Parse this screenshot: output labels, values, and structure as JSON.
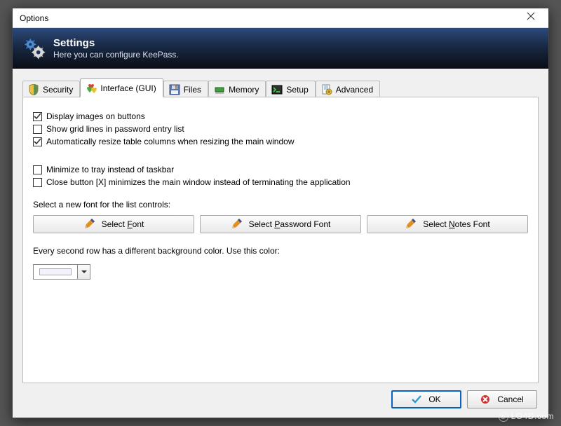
{
  "window": {
    "title": "Options"
  },
  "header": {
    "title": "Settings",
    "subtitle": "Here you can configure KeePass."
  },
  "tabs": [
    {
      "label": "Security",
      "icon": "shield-yellow"
    },
    {
      "label": "Interface (GUI)",
      "icon": "hearts"
    },
    {
      "label": "Files",
      "icon": "floppy"
    },
    {
      "label": "Memory",
      "icon": "chip-green"
    },
    {
      "label": "Setup",
      "icon": "terminal"
    },
    {
      "label": "Advanced",
      "icon": "page-blue"
    }
  ],
  "active_tab": 1,
  "checkboxes": [
    {
      "label": "Display images on buttons",
      "checked": true
    },
    {
      "label": "Show grid lines in password entry list",
      "checked": false
    },
    {
      "label": "Automatically resize table columns when resizing the main window",
      "checked": true
    }
  ],
  "checkboxes2": [
    {
      "label": "Minimize to tray instead of taskbar",
      "checked": false
    },
    {
      "label": "Close button [X] minimizes the main window instead of terminating the application",
      "checked": false
    }
  ],
  "font_section": {
    "label": "Select a new font for the list controls:",
    "buttons": [
      {
        "pre": "Select ",
        "u": "F",
        "post": "ont"
      },
      {
        "pre": "Select ",
        "u": "P",
        "post": "assword Font"
      },
      {
        "pre": "Select ",
        "u": "N",
        "post": "otes Font"
      }
    ]
  },
  "color_section": {
    "label": "Every second row has a different background color. Use this color:",
    "value": "#f2f2fb"
  },
  "dialog_buttons": {
    "ok": "OK",
    "cancel": "Cancel"
  },
  "watermark": "LO4D.com"
}
